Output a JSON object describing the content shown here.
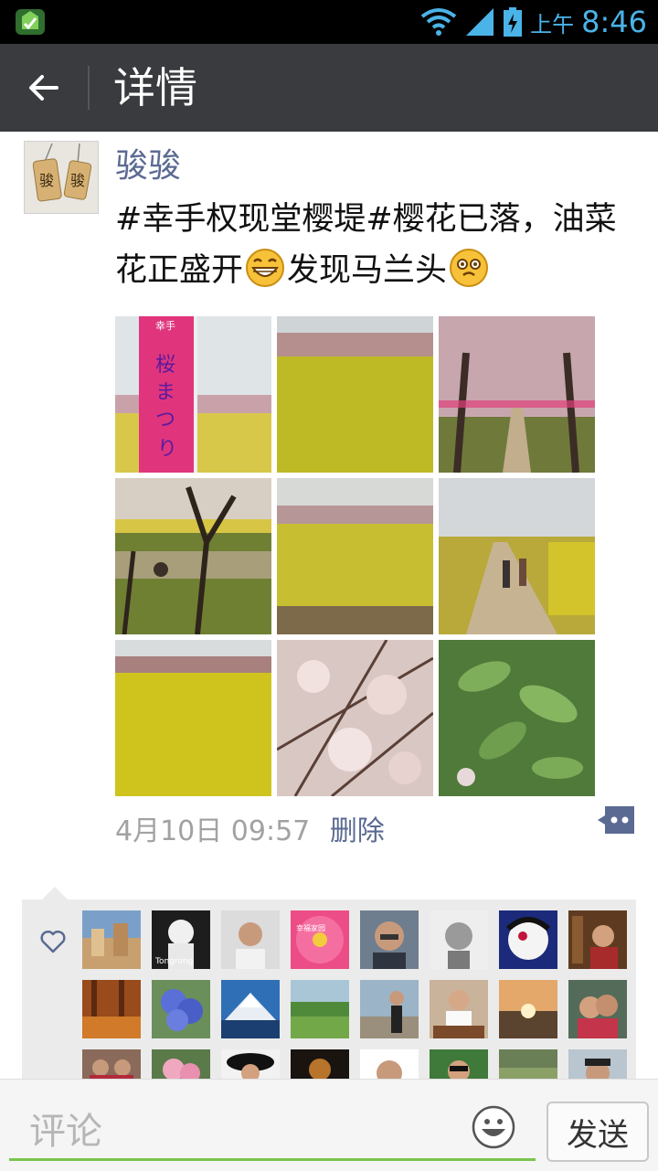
{
  "status": {
    "ampm": "上午",
    "time": "8:46"
  },
  "appbar": {
    "title": "详情"
  },
  "post": {
    "author": "骏骏",
    "text_part1": "#幸手权现堂樱堤#樱花已落，油菜花正盛开",
    "text_part2": "发现马兰头",
    "photos": [
      {
        "name": "photo-sakura-banner",
        "banner_text": "桜まつり",
        "banner_top": "幸手"
      },
      {
        "name": "photo-rapeseed-field-1"
      },
      {
        "name": "photo-cherry-tree-path"
      },
      {
        "name": "photo-tree-picnic"
      },
      {
        "name": "photo-rapeseed-field-2"
      },
      {
        "name": "photo-people-walking"
      },
      {
        "name": "photo-rapeseed-field-3"
      },
      {
        "name": "photo-cherry-blossoms"
      },
      {
        "name": "photo-green-leaves"
      }
    ],
    "timestamp": "4月10日 09:57",
    "delete_label": "删除"
  },
  "likes": {
    "avatars": [
      {
        "name": "avatar-town"
      },
      {
        "name": "avatar-tongrong",
        "text": "Tongrong"
      },
      {
        "name": "avatar-man-glasses"
      },
      {
        "name": "avatar-pink-flower",
        "text": "幸福家园"
      },
      {
        "name": "avatar-man-portrait"
      },
      {
        "name": "avatar-bw-man"
      },
      {
        "name": "avatar-cartoon"
      },
      {
        "name": "avatar-bookshelf-man"
      },
      {
        "name": "avatar-autumn-forest"
      },
      {
        "name": "avatar-blue-flowers"
      },
      {
        "name": "avatar-mount-fuji"
      },
      {
        "name": "avatar-green-field"
      },
      {
        "name": "avatar-selfie-phone"
      },
      {
        "name": "avatar-chef"
      },
      {
        "name": "avatar-sunset"
      },
      {
        "name": "avatar-couple"
      },
      {
        "name": "avatar-family"
      },
      {
        "name": "avatar-roses"
      },
      {
        "name": "avatar-woman-hat"
      },
      {
        "name": "avatar-restaurant"
      },
      {
        "name": "avatar-man-face"
      },
      {
        "name": "avatar-man-sunglasses"
      },
      {
        "name": "avatar-garden"
      },
      {
        "name": "avatar-man-green"
      }
    ]
  },
  "comment_bar": {
    "placeholder": "评论",
    "send_label": "发送"
  }
}
